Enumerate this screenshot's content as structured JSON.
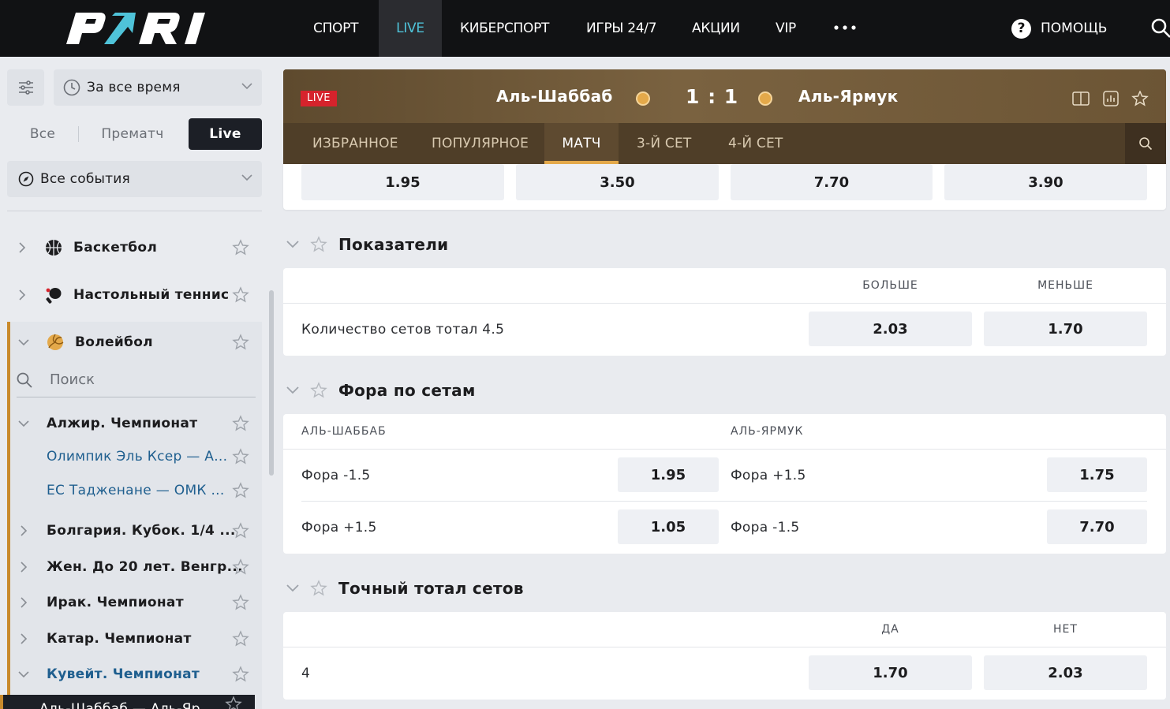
{
  "nav": {
    "items": [
      "СПОРТ",
      "LIVE",
      "КИБЕРСПОРТ",
      "ИГРЫ 24/7",
      "АКЦИИ",
      "VIP"
    ],
    "active": "LIVE",
    "help_label": "ПОМОЩЬ"
  },
  "sidebar": {
    "time_filter": "За все время",
    "modes": [
      "Все",
      "Прематч",
      "Live"
    ],
    "active_mode": "Live",
    "events_filter": "Все события",
    "sports": [
      {
        "label": "Баскетбол",
        "icon": "basketball-icon"
      },
      {
        "label": "Настольный теннис",
        "icon": "table-tennis-icon"
      },
      {
        "label": "Волейбол",
        "icon": "volleyball-icon"
      }
    ],
    "search_placeholder": "Поиск",
    "leagues": [
      {
        "label": "Алжир. Чемпионат",
        "expanded": true
      },
      {
        "label": "Олимпик Эль Ксер — А...",
        "type": "match"
      },
      {
        "label": "ЕС Тадженане — ОМК ...",
        "type": "match"
      },
      {
        "label": "Болгария. Кубок. 1/4 ...",
        "expanded": false
      },
      {
        "label": "Жен. До 20 лет. Венгр...",
        "expanded": false
      },
      {
        "label": "Ирак. Чемпионат",
        "expanded": false
      },
      {
        "label": "Катар. Чемпионат",
        "expanded": false
      },
      {
        "label": "Кувейт. Чемпионат",
        "expanded": true,
        "highlight": true
      },
      {
        "label": "Аль-Шаббаб — Аль-Яр...",
        "type": "match",
        "selected": true
      }
    ]
  },
  "match": {
    "live_badge": "LIVE",
    "home": "Аль-Шаббаб",
    "away": "Аль-Ярмук",
    "score": "1 : 1",
    "tabs": [
      "ИЗБРАННОЕ",
      "ПОПУЛЯРНОЕ",
      "МАТЧ",
      "3-Й СЕТ",
      "4-Й СЕТ"
    ],
    "active_tab": "МАТЧ"
  },
  "top_odds": [
    "1.95",
    "3.50",
    "7.70",
    "3.90"
  ],
  "markets": {
    "indicators": {
      "title": "Показатели",
      "columns": [
        "БОЛЬШЕ",
        "МЕНЬШЕ"
      ],
      "rows": [
        {
          "label": "Количество сетов тотал 4.5",
          "odds": [
            "2.03",
            "1.70"
          ]
        }
      ]
    },
    "handicap": {
      "title": "Фора по сетам",
      "home_col": "АЛЬ-ШАББАБ",
      "away_col": "АЛЬ-ЯРМУК",
      "rows": [
        {
          "home_label": "Фора -1.5",
          "home_odd": "1.95",
          "away_label": "Фора +1.5",
          "away_odd": "1.75"
        },
        {
          "home_label": "Фора +1.5",
          "home_odd": "1.05",
          "away_label": "Фора -1.5",
          "away_odd": "7.70"
        }
      ]
    },
    "exact_total": {
      "title": "Точный тотал сетов",
      "columns": [
        "ДА",
        "НЕТ"
      ],
      "rows": [
        {
          "label": "4",
          "odds": [
            "1.70",
            "2.03"
          ]
        }
      ]
    }
  },
  "colors": {
    "accent": "#4fc3d9",
    "live_red": "#d6232c",
    "volley_accent": "#c98a2c",
    "header_brown": "#6d5636"
  }
}
